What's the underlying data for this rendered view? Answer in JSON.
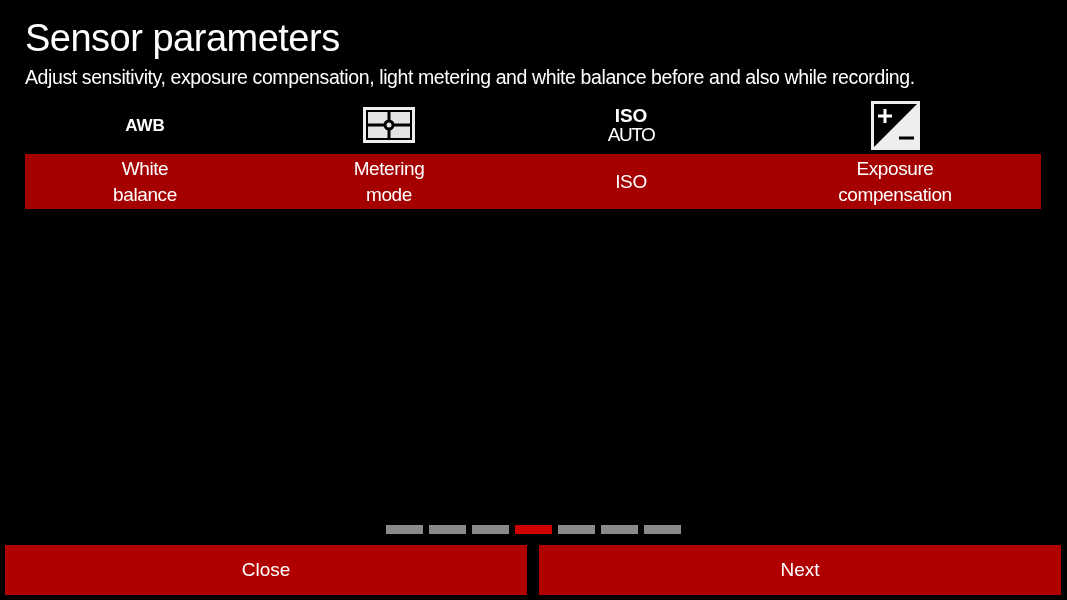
{
  "title": "Sensor parameters",
  "description": "Adjust sensitivity, exposure compensation, light metering and white balance before and also while recording.",
  "parameters": [
    {
      "kind": "text",
      "icon_lines": [
        "AWB"
      ],
      "label": "White\nbalance"
    },
    {
      "kind": "metering",
      "label": "Metering\nmode"
    },
    {
      "kind": "text",
      "icon_lines": [
        "ISO",
        "AUTO"
      ],
      "label": "ISO"
    },
    {
      "kind": "exposure",
      "label": "Exposure\ncompensation"
    }
  ],
  "pager": [
    {
      "selected": false
    },
    {
      "selected": false
    },
    {
      "selected": false
    },
    {
      "selected": true
    },
    {
      "selected": false
    },
    {
      "selected": false
    },
    {
      "selected": false
    }
  ],
  "buttons": [
    "Close",
    "Next"
  ]
}
